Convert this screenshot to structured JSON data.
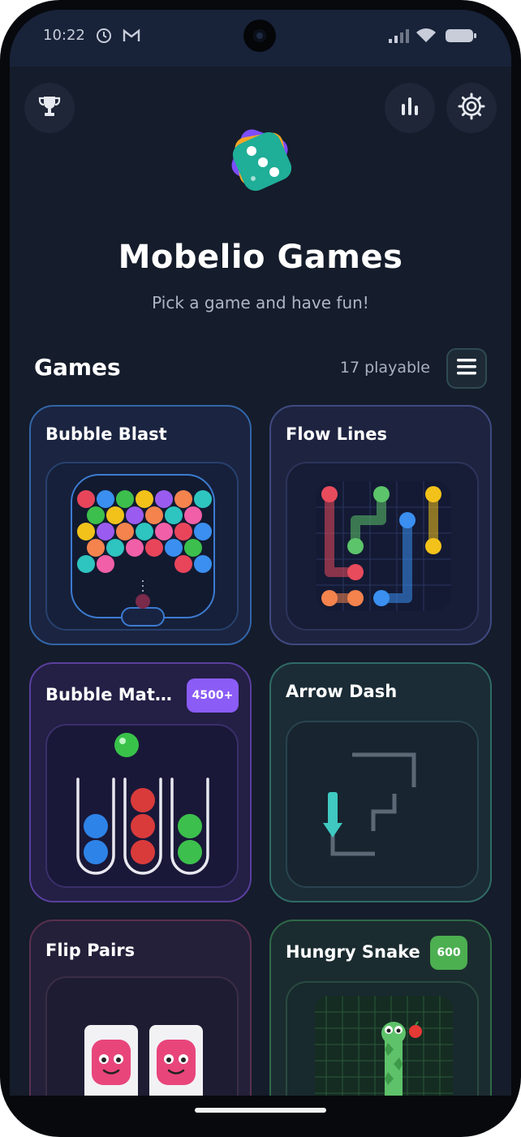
{
  "status_bar": {
    "time": "10:22"
  },
  "header": {
    "title": "Mobelio Games",
    "subtitle": "Pick a game and have fun!"
  },
  "games_section": {
    "title": "Games",
    "count_label": "17 playable"
  },
  "games": [
    {
      "title": "Bubble Blast"
    },
    {
      "title": "Flow Lines"
    },
    {
      "title": "Bubble Mat…",
      "badge": "4500+"
    },
    {
      "title": "Arrow Dash"
    },
    {
      "title": "Flip Pairs"
    },
    {
      "title": "Hungry Snake",
      "badge": "600"
    }
  ],
  "colors": {
    "background": "#151c2b",
    "accent_teal": "#2ec4a6",
    "badge_purple": "#8b5cf6",
    "badge_green": "#4caf50"
  },
  "icons": [
    "clock-icon",
    "gmail-icon",
    "signal-icon",
    "wifi-icon",
    "battery-icon",
    "trophy-icon",
    "stats-icon",
    "settings-icon",
    "dice-logo-icon",
    "menu-icon"
  ]
}
